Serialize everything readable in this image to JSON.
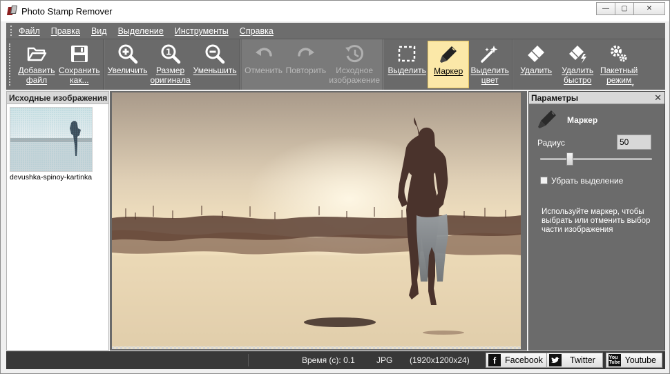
{
  "window": {
    "title": "Photo Stamp Remover",
    "controls": {
      "minimize": "—",
      "maximize": "▢",
      "close": "✕"
    }
  },
  "menu": {
    "items": [
      "Файл",
      "Правка",
      "Вид",
      "Выделение",
      "Инструменты",
      "Справка"
    ]
  },
  "toolbar": {
    "add_file": "Добавить\nфайл",
    "save_as": "Сохранить\nкак...",
    "zoom_in": "Увеличить",
    "original_size": "Размер\nоригинала",
    "zoom_out": "Уменьшить",
    "undo": "Отменить",
    "redo": "Повторить",
    "original_image": "Исходное\nизображение",
    "select": "Выделить",
    "marker": "Маркер",
    "select_color": "Выделить\nцвет",
    "remove": "Удалить",
    "remove_fast": "Удалить\nбыстро",
    "batch_mode": "Пакетный\nрежим"
  },
  "left_panel": {
    "header": "Исходные изображения",
    "thumbnail_name": "devushka-spinoy-kartinka"
  },
  "right_panel": {
    "header": "Параметры",
    "close": "✕",
    "tool_name": "Маркер",
    "radius_label": "Радиус",
    "radius_value": "50",
    "radius_slider_level": 0.25,
    "checkbox_label": "Убрать выделение",
    "checkbox_checked": false,
    "hint": "Используйте маркер, чтобы выбрать или отменить выбор части изображения"
  },
  "status": {
    "time": "Время (с): 0.1",
    "format": "JPG",
    "resolution": "(1920x1200x24)"
  },
  "social": {
    "facebook": "Facebook",
    "twitter": "Twitter",
    "youtube": "Youtube"
  },
  "colors": {
    "toolbar": "#6a6a6a",
    "active_tool": "#fbe8a8",
    "statusbar": "#383838"
  }
}
